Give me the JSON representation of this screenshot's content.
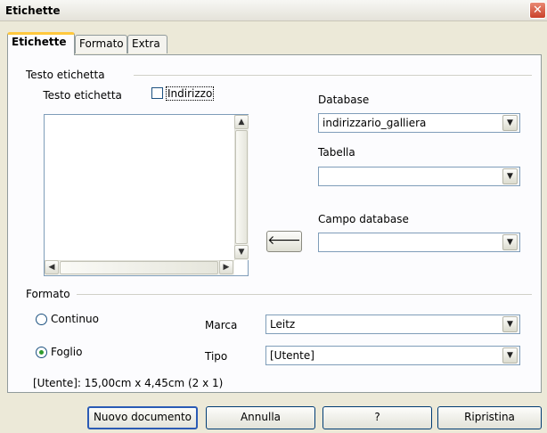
{
  "window": {
    "title": "Etichette",
    "close_icon": "✕"
  },
  "tabs": [
    {
      "label": "Etichette"
    },
    {
      "label": "Formato"
    },
    {
      "label": "Extra"
    }
  ],
  "labels_section": {
    "heading": "Testo etichetta",
    "text_label": "Testo etichetta",
    "address_checkbox": {
      "label": "Indirizzo",
      "checked": false
    },
    "database_label": "Database",
    "database_value": "indirizzario_galliera",
    "table_label": "Tabella",
    "table_value": "",
    "field_label": "Campo database",
    "field_value": "",
    "insert_arrow": "🡐"
  },
  "format_section": {
    "heading": "Formato",
    "continuous_label": "Continuo",
    "sheet_label": "Foglio",
    "selected": "sheet",
    "brand_label": "Marca",
    "brand_value": "Leitz",
    "type_label": "Tipo",
    "type_value": "[Utente]",
    "info": "[Utente]: 15,00cm x 4,45cm (2 x 1)"
  },
  "buttons": {
    "new_document": "Nuovo documento",
    "cancel": "Annulla",
    "help": "?",
    "reset": "Ripristina"
  }
}
